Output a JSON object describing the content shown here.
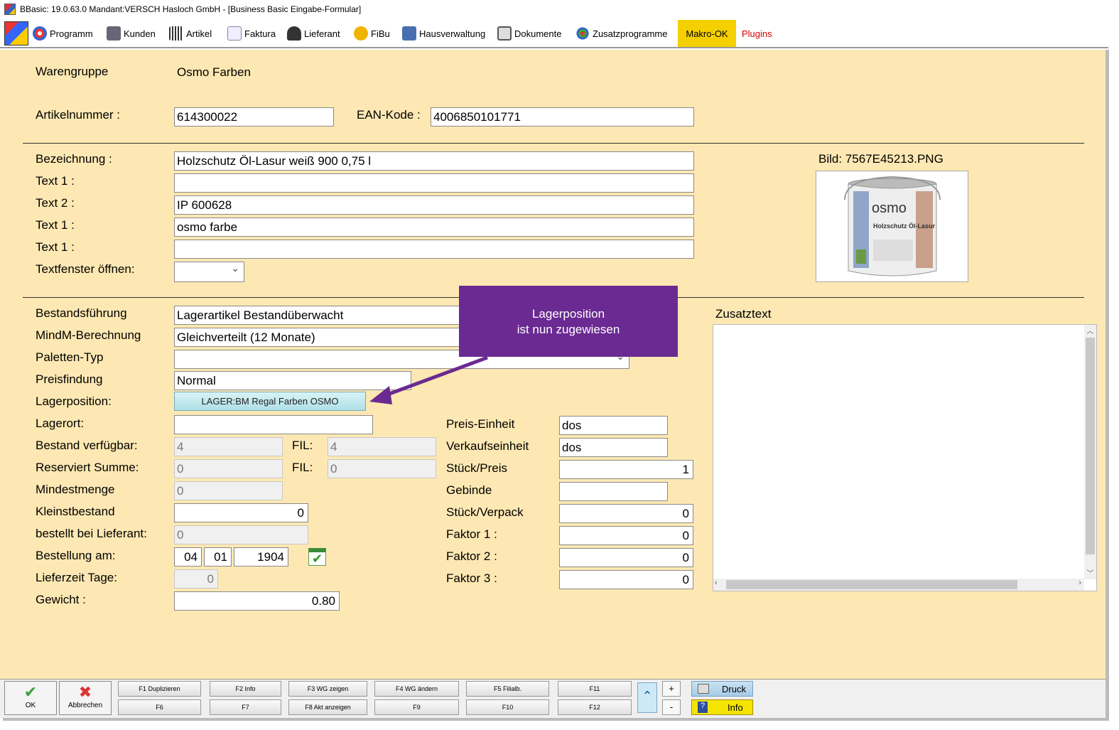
{
  "window": {
    "title": "BBasic: 19.0.63.0 Mandant:VERSCH Hasloch GmbH  - [Business Basic Eingabe-Formular]"
  },
  "menu": {
    "items": [
      {
        "label": "Programm"
      },
      {
        "label": "Kunden"
      },
      {
        "label": "Artikel"
      },
      {
        "label": "Faktura"
      },
      {
        "label": "Lieferant"
      },
      {
        "label": "FiBu"
      },
      {
        "label": "Hausverwaltung"
      },
      {
        "label": "Dokumente"
      },
      {
        "label": "Zusatzprogramme"
      },
      {
        "label": "Makro-OK"
      },
      {
        "label": "Plugins"
      }
    ],
    "colors": {
      "makro_bg": "#f5d000",
      "plugins_text": "#d00000"
    }
  },
  "form": {
    "warengruppe": {
      "label": "Warengruppe",
      "value": "Osmo Farben"
    },
    "artikelnummer": {
      "label": "Artikelnummer :",
      "value": "614300022"
    },
    "ean": {
      "label": "EAN-Kode :",
      "value": "4006850101771"
    },
    "bezeichnung": {
      "label": "Bezeichnung :",
      "value": "Holzschutz Öl-Lasur weiß 900 0,75 l"
    },
    "text1a": {
      "label": "Text 1 :",
      "value": ""
    },
    "text2": {
      "label": "Text 2 :",
      "value": "IP 600628"
    },
    "text1b": {
      "label": "Text 1 :",
      "value": "osmo farbe"
    },
    "text1c": {
      "label": "Text 1 :",
      "value": ""
    },
    "textfenster": {
      "label": "Textfenster öffnen:",
      "value": ""
    },
    "bild": {
      "label": "Bild: 7567E45213.PNG",
      "product_brand": "osmo",
      "product_name": "Holzschutz Öl-Lasur"
    },
    "bestandsfuehrung": {
      "label": "Bestandsführung",
      "value": "Lagerartikel Bestandüberwacht"
    },
    "mindm": {
      "label": "MindM-Berechnung",
      "value": "Gleichverteilt (12 Monate)"
    },
    "paletten": {
      "label": "Paletten-Typ",
      "value": ""
    },
    "preisfindung": {
      "label": "Preisfindung",
      "value": "Normal"
    },
    "lagerposition": {
      "label": "Lagerposition:",
      "value": "LAGER:BM Regal Farben OSMO"
    },
    "lagerort": {
      "label": "Lagerort:",
      "value": ""
    },
    "bestand": {
      "label": "Bestand verfügbar:",
      "value": "4",
      "fil_label": "FIL:",
      "fil_value": "4"
    },
    "reserviert": {
      "label": "Reserviert Summe:",
      "value": "0",
      "fil_label": "FIL:",
      "fil_value": "0"
    },
    "mindestmenge": {
      "label": "Mindestmenge",
      "value": "0"
    },
    "kleinstbestand": {
      "label": "Kleinstbestand",
      "value": "0"
    },
    "bestellt": {
      "label": "bestellt bei Lieferant:",
      "value": "0"
    },
    "bestellung": {
      "label": "Bestellung am:",
      "day": "04",
      "month": "01",
      "year": "1904"
    },
    "lieferzeit": {
      "label": "Lieferzeit Tage:",
      "value": "0"
    },
    "gewicht": {
      "label": "Gewicht :",
      "value": "0.80"
    },
    "preiseinheit": {
      "label": "Preis-Einheit",
      "value": "dos"
    },
    "verkaufseinheit": {
      "label": "Verkaufseinheit",
      "value": "dos"
    },
    "stueckpreis": {
      "label": "Stück/Preis",
      "value": "1"
    },
    "gebinde": {
      "label": "Gebinde",
      "value": ""
    },
    "stueckverpack": {
      "label": "Stück/Verpack",
      "value": "0"
    },
    "faktor1": {
      "label": "Faktor 1 :",
      "value": "0"
    },
    "faktor2": {
      "label": "Faktor 2 :",
      "value": "0"
    },
    "faktor3": {
      "label": "Faktor 3 :",
      "value": "0"
    },
    "zusatztext": {
      "label": "Zusatztext",
      "value": ""
    }
  },
  "callout": {
    "line1": "Lagerposition",
    "line2": "ist nun zugewiesen"
  },
  "bottom": {
    "ok": "OK",
    "abbrechen": "Abbrechen",
    "f1": "F1 Duplizieren",
    "f2": "F2 Info",
    "f3": "F3 WG zeigen",
    "f4": "F4 WG ändern",
    "f5": "F5 Filialb.",
    "f11": "F11",
    "f6": "F6",
    "f7": "F7",
    "f8": "F8 Akt anzeigen",
    "f9": "F9",
    "f10": "F10",
    "f12": "F12",
    "plus": "+",
    "minus": "-",
    "druck": "Druck",
    "info": "Info"
  }
}
